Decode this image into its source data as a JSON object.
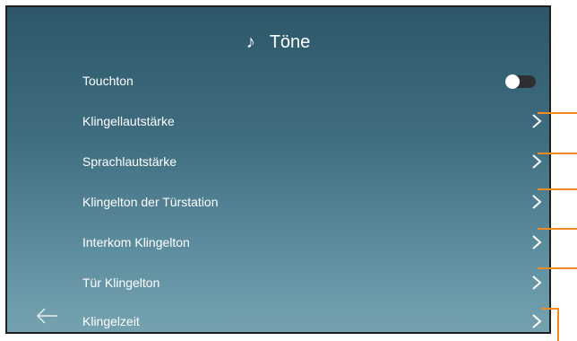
{
  "header": {
    "icon": "music-note-icon",
    "title": "Töne"
  },
  "rows": [
    {
      "label": "Touchton",
      "control": "toggle",
      "state": "off"
    },
    {
      "label": "Klingellautstärke",
      "control": "chevron"
    },
    {
      "label": "Sprachlautstärke",
      "control": "chevron"
    },
    {
      "label": "Klingelton der Türstation",
      "control": "chevron"
    },
    {
      "label": "Interkom Klingelton",
      "control": "chevron"
    },
    {
      "label": "Tür Klingelton",
      "control": "chevron"
    },
    {
      "label": "Klingelzeit",
      "control": "chevron"
    }
  ],
  "colors": {
    "callout": "#f28a1f",
    "toggle_track": "#2d2f33"
  }
}
